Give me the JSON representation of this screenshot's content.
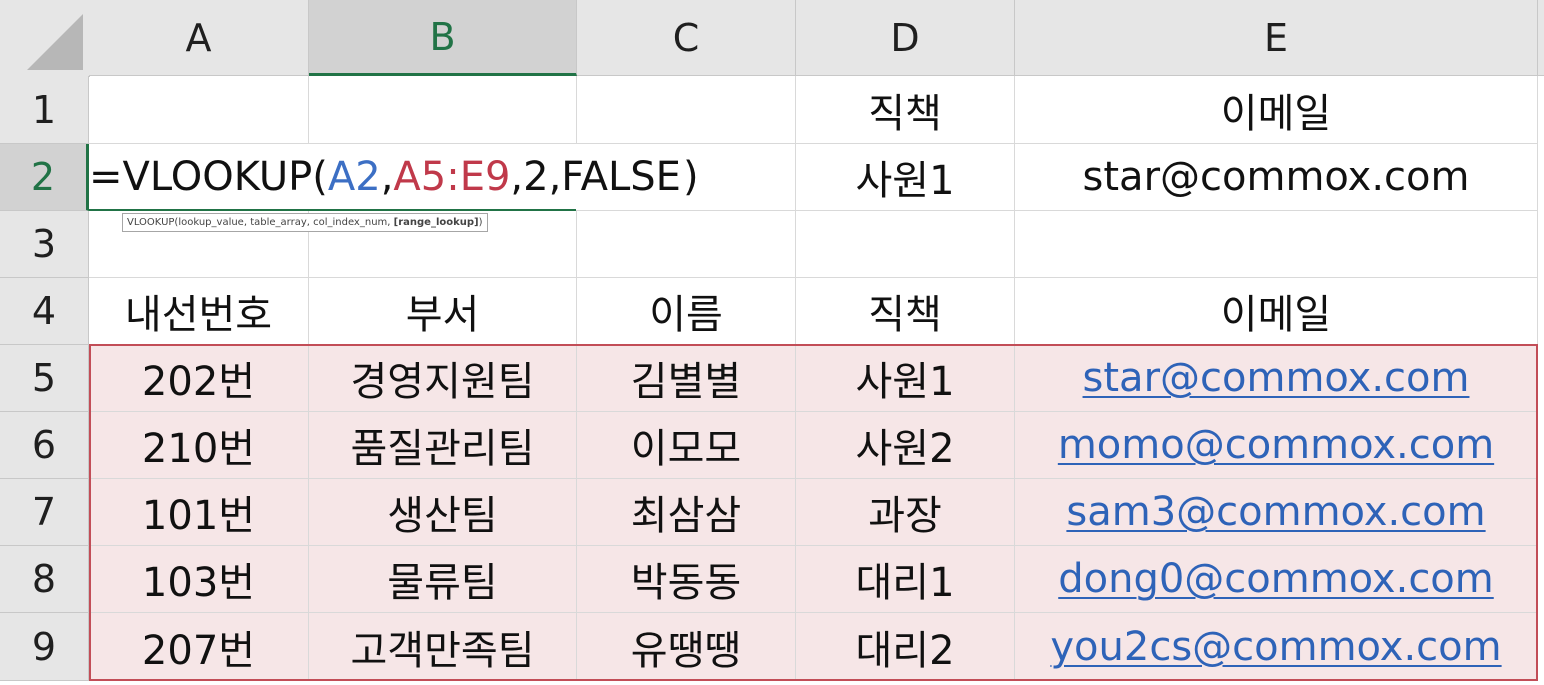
{
  "columns": [
    "A",
    "B",
    "C",
    "D",
    "E"
  ],
  "rows": [
    "1",
    "2",
    "3",
    "4",
    "5",
    "6",
    "7",
    "8",
    "9"
  ],
  "lookup": {
    "header_title": "직책",
    "header_email": "이메일",
    "formula": {
      "prefix": "=VLOOKUP(",
      "ref_a": "A2",
      "sep1": ",",
      "ref_b": "A5:E9",
      "sep2": ",2,FALSE",
      "suffix": ")"
    },
    "result_title": "사원1",
    "result_email": "star@commox.com",
    "tooltip": {
      "prefix": "VLOOKUP(lookup_value, table_array, col_index_num, ",
      "optional": "[range_lookup]",
      "suffix": ")"
    }
  },
  "table": {
    "headers": [
      "내선번호",
      "부서",
      "이름",
      "직책",
      "이메일"
    ],
    "rows": [
      [
        "202번",
        "경영지원팀",
        "김별별",
        "사원1",
        "star@commox.com"
      ],
      [
        "210번",
        "품질관리팀",
        "이모모",
        "사원2",
        "momo@commox.com"
      ],
      [
        "101번",
        "생산팀",
        "최삼삼",
        "과장",
        "sam3@commox.com"
      ],
      [
        "103번",
        "물류팀",
        "박동동",
        "대리1",
        "dong0@commox.com"
      ],
      [
        "207번",
        "고객만족팀",
        "유땡땡",
        "대리2",
        "you2cs@commox.com"
      ]
    ]
  },
  "colors": {
    "accent": "#217346",
    "ref_a": "#3c6fc4",
    "ref_b": "#c0394a",
    "range_fill": "#f6e6e7",
    "range_border": "#c24d57",
    "link": "#2e63b8"
  }
}
